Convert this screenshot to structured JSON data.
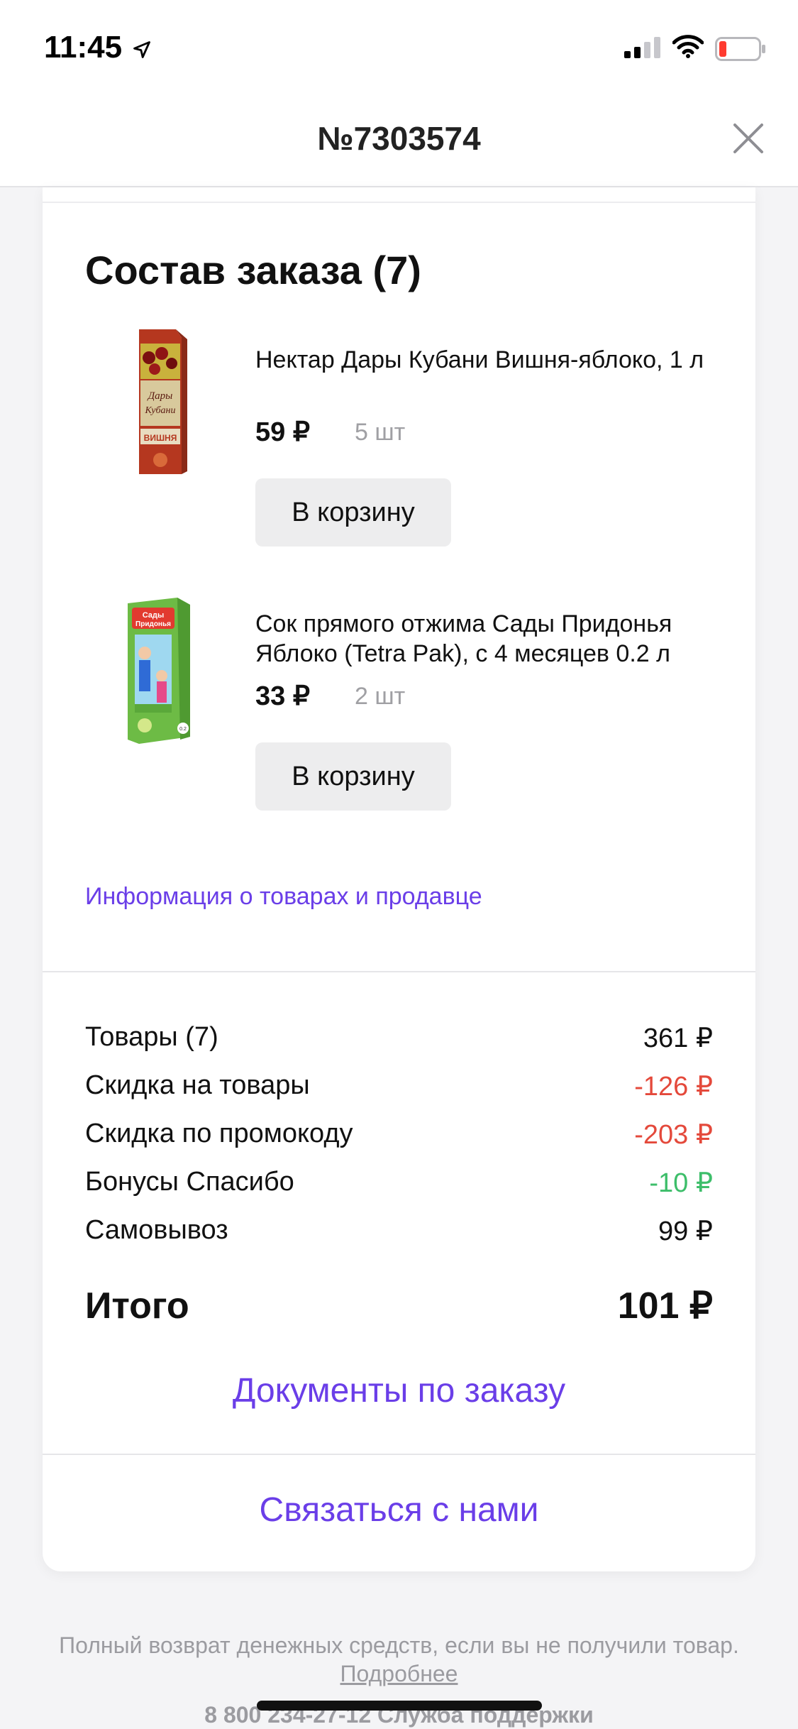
{
  "status_bar": {
    "time": "11:45"
  },
  "nav": {
    "title": "№7303574"
  },
  "order": {
    "title": "Состав заказа (7)",
    "items": [
      {
        "name": "Нектар Дары Кубани Вишня-яблоко, 1 л",
        "price": "59 ₽",
        "qty": "5 шт",
        "button": "В корзину",
        "image_brand": "Дары Кубани",
        "image_label": "ВИШНЯ"
      },
      {
        "name": "Сок прямого отжима Сады Придонья Яблоко (Tetra Pak), с 4 месяцев 0.2 л",
        "price": "33 ₽",
        "qty": "2 шт",
        "button": "В корзину",
        "image_brand": "Сады Придонья"
      }
    ],
    "info_link": "Информация о товарах и продавце"
  },
  "summary": {
    "rows": [
      {
        "label": "Товары (7)",
        "value": "361 ₽",
        "tone": "normal"
      },
      {
        "label": "Скидка на товары",
        "value": "-126 ₽",
        "tone": "red"
      },
      {
        "label": "Скидка по промокоду",
        "value": "-203 ₽",
        "tone": "red"
      },
      {
        "label": "Бонусы Спасибо",
        "value": "-10 ₽",
        "tone": "green"
      },
      {
        "label": "Самовывоз",
        "value": "99 ₽",
        "tone": "normal"
      }
    ],
    "total_label": "Итого",
    "total_value": "101 ₽",
    "docs_link": "Документы по заказу",
    "contact_link": "Связаться с нами"
  },
  "footer": {
    "note": "Полный возврат денежных средств, если вы не получили товар.",
    "more_link": "Подробнее",
    "phone": "8 800 234-27-12 Служба поддержки"
  },
  "colors": {
    "accent": "#6a3ee8",
    "discount": "#e4493b",
    "bonus": "#3dbe6a"
  },
  "icons": [
    "location-arrow-icon",
    "signal-icon",
    "wifi-icon",
    "battery-low-icon",
    "close-icon"
  ]
}
